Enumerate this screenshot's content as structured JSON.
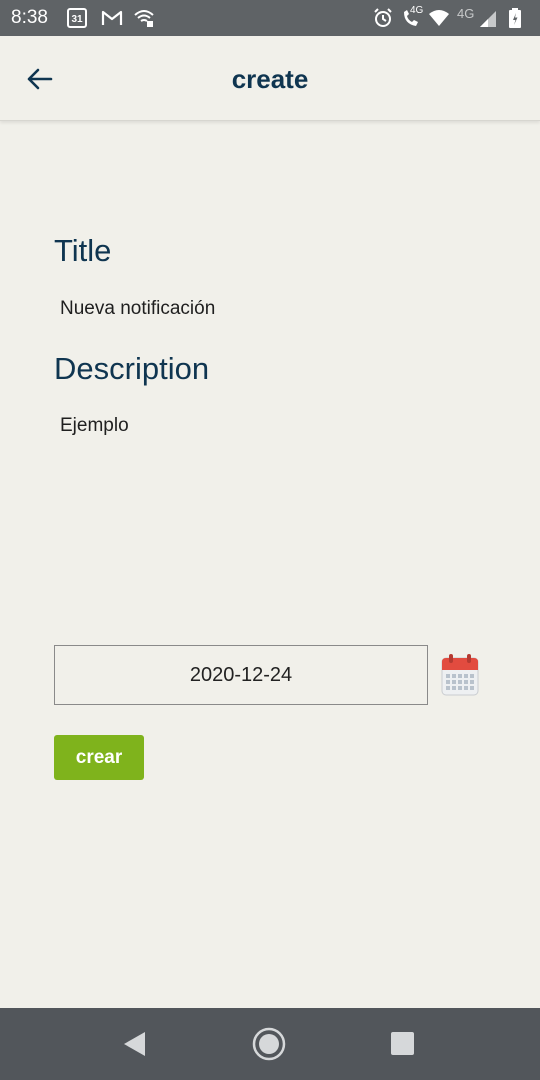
{
  "status_bar": {
    "time": "8:38",
    "calendar_day": "31",
    "network_label_1": "4G",
    "network_label_2": "4G",
    "icons": [
      "calendar-icon",
      "gmail-icon",
      "wifi-calling-icon",
      "alarm-icon",
      "volte-call-icon",
      "wifi-icon",
      "cellular-signal-icon",
      "battery-icon"
    ]
  },
  "app_bar": {
    "title": "create",
    "back_icon": "arrow-back-icon"
  },
  "form": {
    "title_label": "Title",
    "title_value": "Nueva notificación",
    "description_label": "Description",
    "description_value": "Ejemplo",
    "date_value": "2020-12-24",
    "calendar_icon": "calendar-icon",
    "submit_label": "crear"
  },
  "colors": {
    "background": "#f1f0ea",
    "heading": "#0f3550",
    "button": "#7fb31c",
    "status_bar": "#5f6366",
    "nav_bar": "#52565b",
    "calendar_header": "#e24b3f"
  },
  "nav_bar": {
    "icons": [
      "back-triangle-icon",
      "home-circle-icon",
      "recents-square-icon"
    ]
  }
}
